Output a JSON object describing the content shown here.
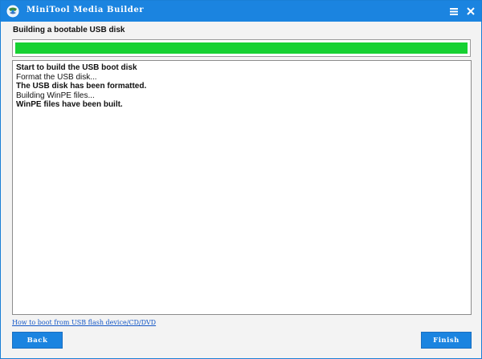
{
  "window": {
    "title": "MiniTool Media Builder",
    "accent_color": "#1b84e0"
  },
  "titlebar": {
    "app_icon": "globe-disc-icon",
    "menu_icon": "hamburger-menu-icon",
    "close_icon": "close-icon"
  },
  "main": {
    "heading": "Building a bootable USB disk",
    "progress": {
      "percent": 100,
      "fill_color": "#16d132"
    },
    "log": [
      {
        "text": "Start to build the USB boot disk",
        "bold": true
      },
      {
        "text": "Format the USB disk...",
        "bold": false
      },
      {
        "text": "The USB disk has been formatted.",
        "bold": true
      },
      {
        "text": "Building WinPE files...",
        "bold": false
      },
      {
        "text": "WinPE files have been built.",
        "bold": true
      }
    ],
    "help_link": "How to boot from USB flash device/CD/DVD"
  },
  "footer": {
    "back_label": "Back",
    "finish_label": "Finish"
  }
}
